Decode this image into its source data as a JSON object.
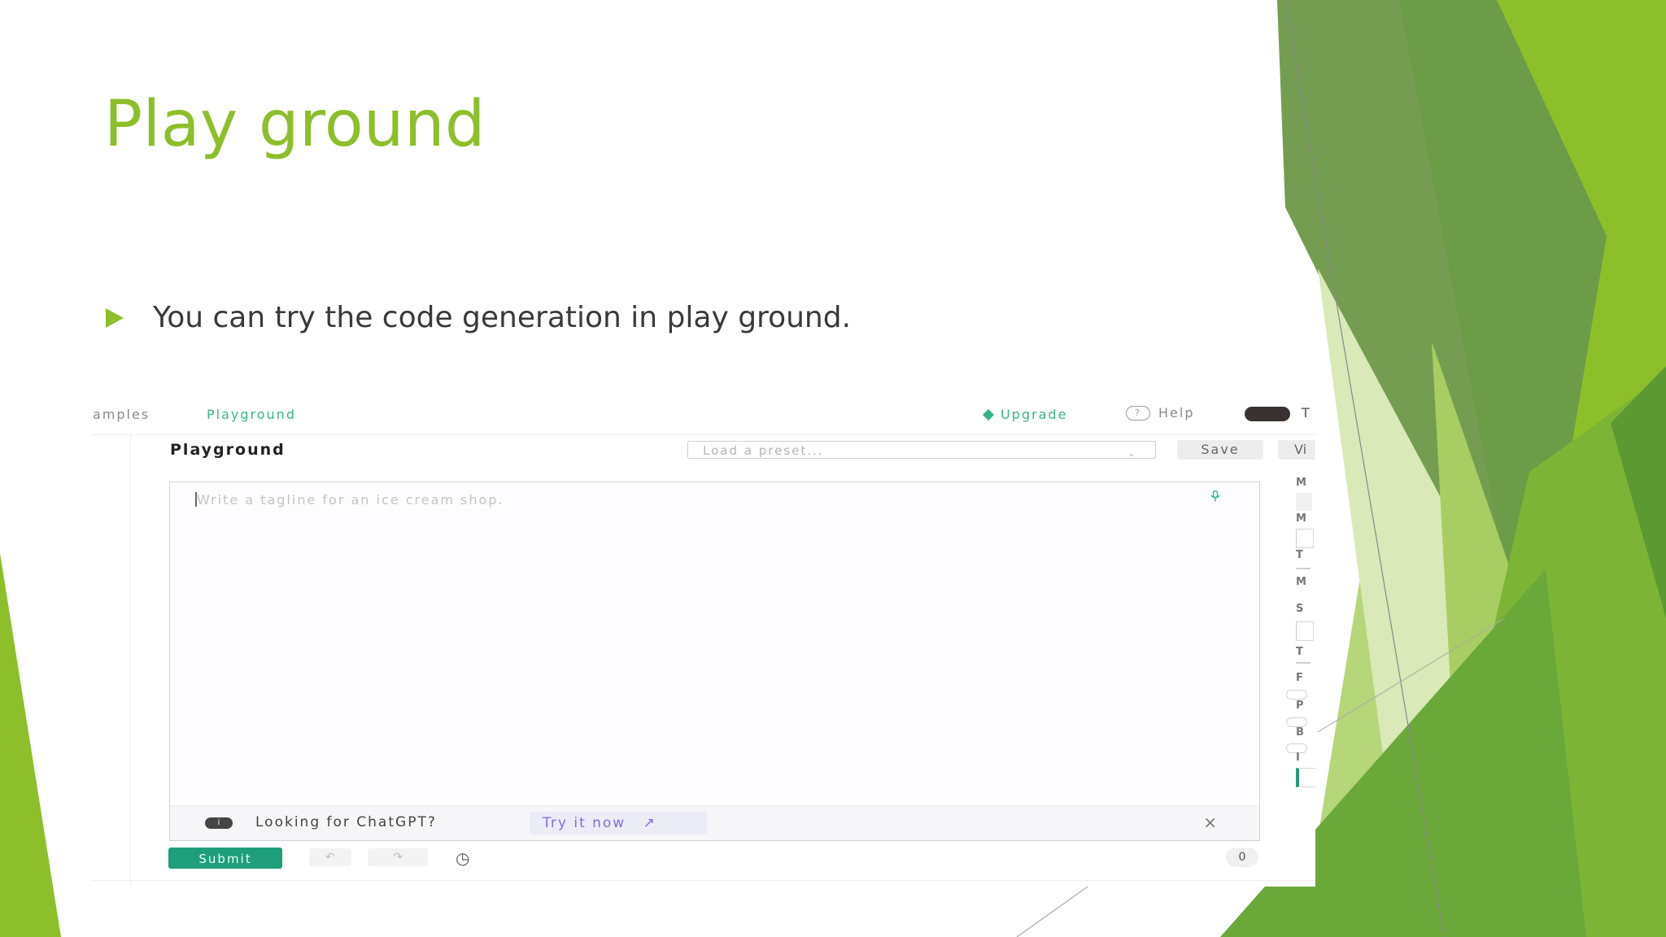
{
  "slide": {
    "title": "Play ground",
    "bullet": "You can try the code generation in play ground.",
    "colors": {
      "accent": "#8cbf2a",
      "text": "#3a3a3a"
    }
  },
  "screenshot": {
    "nav": {
      "examples": "amples",
      "playground": "Playground",
      "upgrade": "Upgrade",
      "help": "Help",
      "user_initial": "T"
    },
    "heading": "Playground",
    "preset_placeholder": "Load a preset...",
    "save_label": "Save",
    "view_label": "Vi",
    "editor_placeholder": "Write a tagline for an ice cream shop.",
    "banner": {
      "text": "Looking for ChatGPT?",
      "link": "Try it now"
    },
    "submit_label": "Submit",
    "token_count": "0",
    "right_panel_labels": [
      "M",
      "M",
      "T",
      "M",
      "S",
      "T",
      "F",
      "P",
      "B",
      "I"
    ],
    "colors": {
      "green": "#1f9e7a",
      "link": "#7b6ee0"
    }
  }
}
